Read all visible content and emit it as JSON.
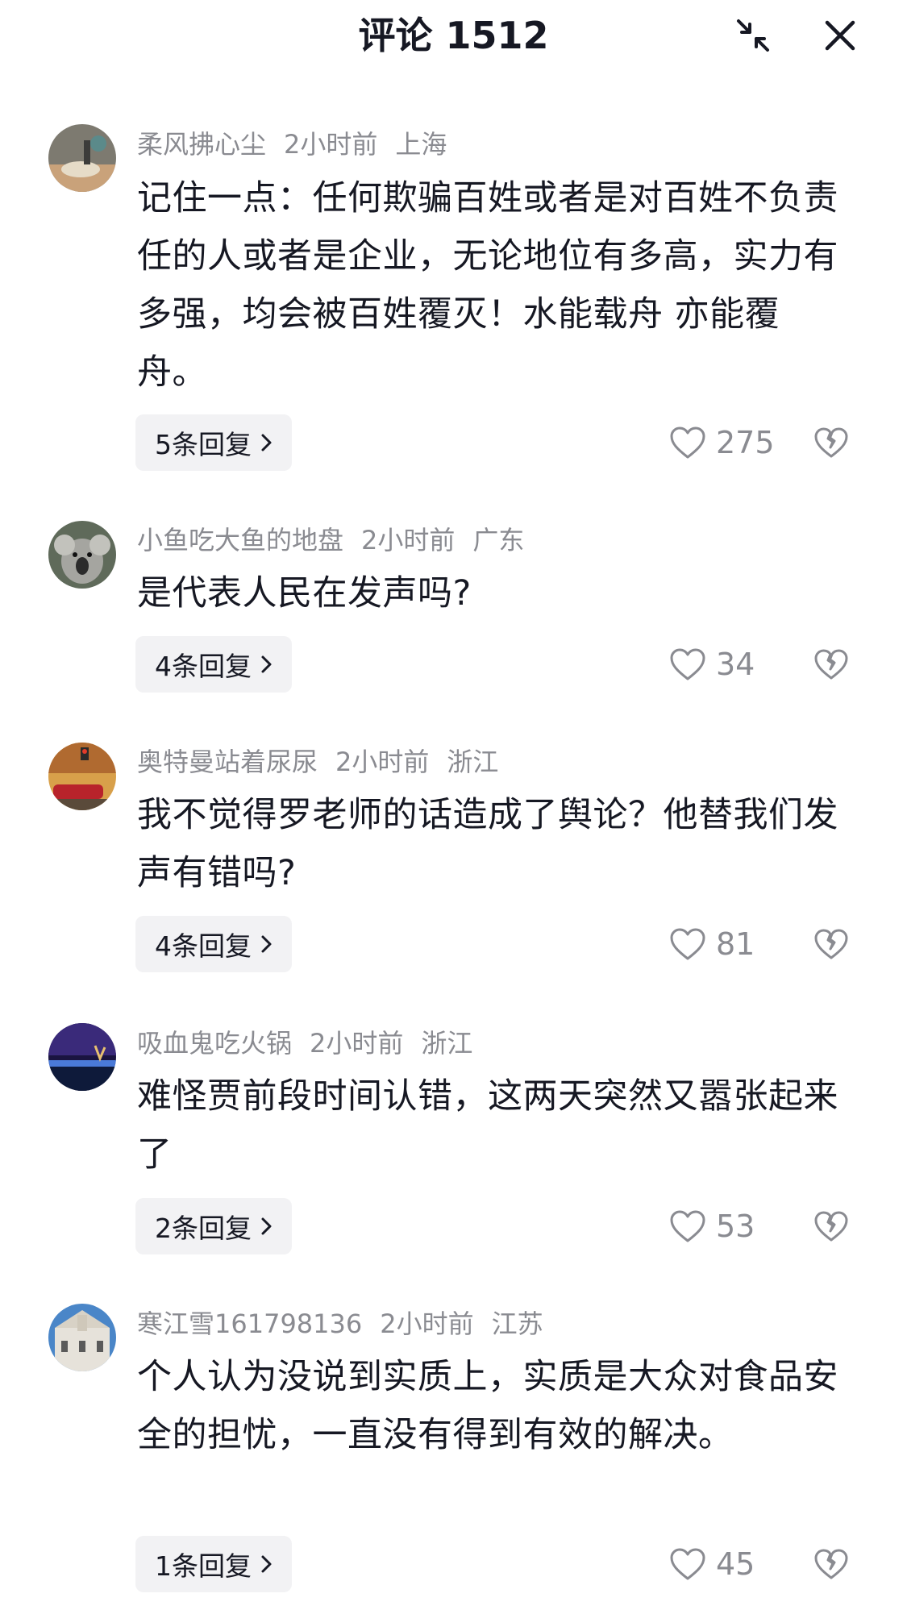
{
  "header": {
    "title": "评论 1512",
    "shrink_icon": "shrink-arrows-icon",
    "close_icon": "close-icon"
  },
  "comments": [
    {
      "username": "柔风拂心尘",
      "time": "2小时前",
      "location": "上海",
      "text": "记住一点：任何欺骗百姓或者是对百姓不负责任的人或者是企业，无论地位有多高，实力有多强，均会被百姓覆灭！水能载舟 亦能覆舟。",
      "replies": "5条回复",
      "likes": "275"
    },
    {
      "username": "小鱼吃大鱼的地盘",
      "time": "2小时前",
      "location": "广东",
      "text": "是代表人民在发声吗?",
      "replies": "4条回复",
      "likes": "34"
    },
    {
      "username": "奥特曼站着尿尿",
      "time": "2小时前",
      "location": "浙江",
      "text": "我不觉得罗老师的话造成了舆论？他替我们发声有错吗?",
      "replies": "4条回复",
      "likes": "81"
    },
    {
      "username": "吸血鬼吃火锅",
      "time": "2小时前",
      "location": "浙江",
      "text": "难怪贾前段时间认错，这两天突然又嚣张起来了",
      "replies": "2条回复",
      "likes": "53"
    },
    {
      "username": "寒江雪161798136",
      "time": "2小时前",
      "location": "江苏",
      "text": "个人认为没说到实质上，实质是大众对食品安全的担忧，一直没有得到有效的解决。",
      "replies": "1条回复",
      "likes": "45"
    }
  ],
  "colors": {
    "text": "#161823",
    "secondary": "#8a8b91",
    "reply_bg": "#f2f2f4"
  }
}
